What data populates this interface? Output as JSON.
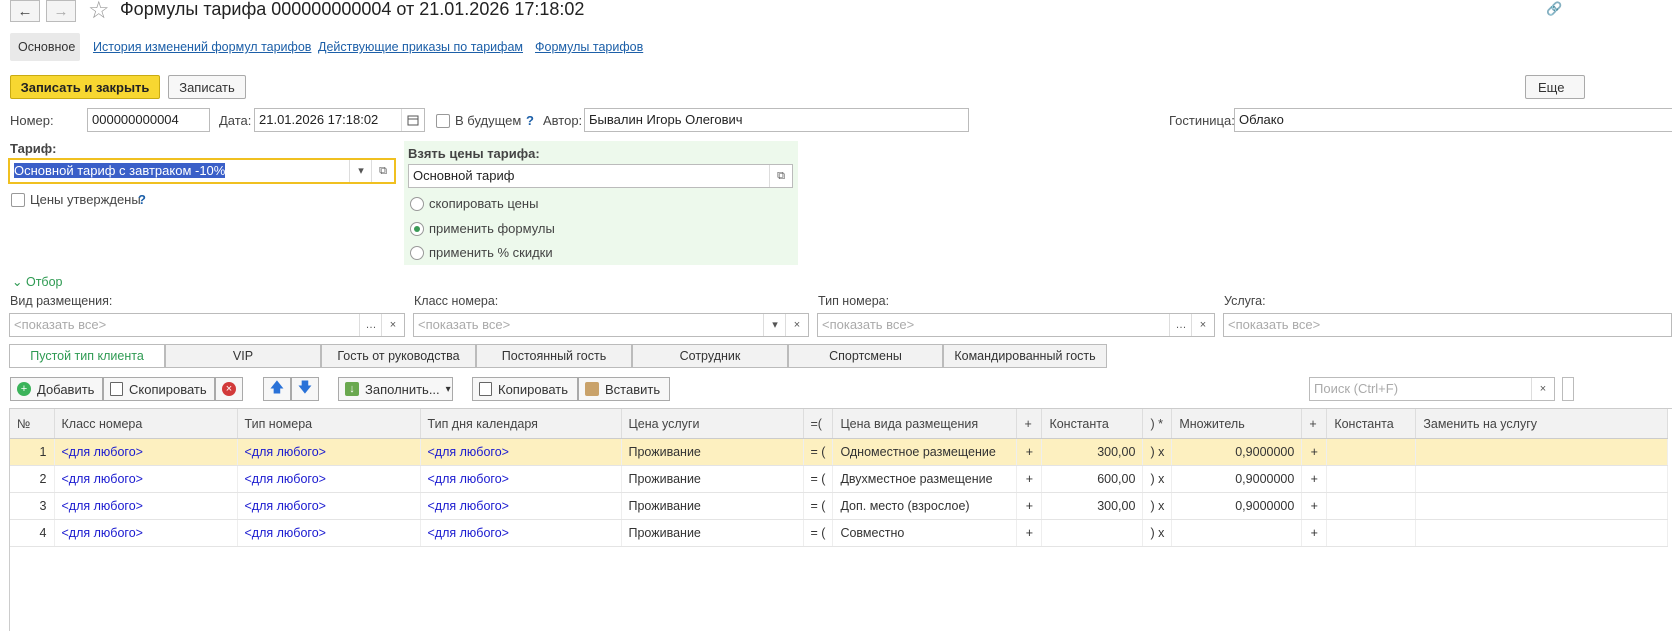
{
  "window": {
    "title": "Формулы тарифа 000000000004 от 21.01.2026 17:18:02"
  },
  "nav": {
    "back": "←",
    "forward": "→",
    "star": "☆",
    "link": "🔗"
  },
  "tabs": [
    "Основное",
    "История изменений формул тарифов",
    "Действующие приказы по тарифам",
    "Формулы тарифов"
  ],
  "toolbar": {
    "save_close": "Записать и закрыть",
    "save": "Записать",
    "more": "Еще"
  },
  "header": {
    "number_label": "Номер:",
    "number_value": "000000000004",
    "date_label": "Дата:",
    "date_value": "21.01.2026 17:18:02",
    "future_label": "В будущем",
    "help": "?",
    "author_label": "Автор:",
    "author_value": "Бывалин Игорь Олегович",
    "hotel_label": "Гостиница:",
    "hotel_value": "Облако"
  },
  "tariff": {
    "label": "Тариф:",
    "value": "Основной тариф с завтраком -10%",
    "approved_label": "Цены утверждены",
    "help": "?"
  },
  "prices": {
    "label": "Взять цены тарифа:",
    "value": "Основной тариф",
    "options": [
      {
        "label": "скопировать цены",
        "selected": false
      },
      {
        "label": "применить формулы",
        "selected": true
      },
      {
        "label": "применить % скидки",
        "selected": false
      }
    ]
  },
  "filter": {
    "toggle": "Отбор",
    "placement_label": "Вид размещения:",
    "room_class_label": "Класс номера:",
    "room_type_label": "Тип номера:",
    "service_label": "Услуга:",
    "placeholder": "<показать все>"
  },
  "client_tabs": [
    "Пустой тип клиента",
    "VIP",
    "Гость от руководства",
    "Постоянный гость",
    "Сотрудник",
    "Спортсмены",
    "Командированный гость"
  ],
  "table_toolbar": {
    "add": "Добавить",
    "copy": "Скопировать",
    "fill": "Заполнить...",
    "copy2": "Копировать",
    "paste": "Вставить",
    "search_placeholder": "Поиск (Ctrl+F)"
  },
  "table": {
    "columns": [
      "№",
      "Класс номера",
      "Тип номера",
      "Тип дня календаря",
      "Цена услуги",
      "=(",
      "Цена вида размещения",
      "+",
      "Константа",
      ") *",
      "Множитель",
      "+",
      "Константа",
      "Заменить на услугу"
    ],
    "rows": [
      [
        "1",
        "<для любого>",
        "<для любого>",
        "<для любого>",
        "Проживание",
        "= (",
        "Одноместное размещение",
        "+",
        "300,00",
        ") x",
        "0,9000000",
        "+",
        "",
        ""
      ],
      [
        "2",
        "<для любого>",
        "<для любого>",
        "<для любого>",
        "Проживание",
        "= (",
        "Двухместное размещение",
        "+",
        "600,00",
        ") x",
        "0,9000000",
        "+",
        "",
        ""
      ],
      [
        "3",
        "<для любого>",
        "<для любого>",
        "<для любого>",
        "Проживание",
        "= (",
        "Доп. место (взрослое)",
        "+",
        "300,00",
        ") x",
        "0,9000000",
        "+",
        "",
        ""
      ],
      [
        "4",
        "<для любого>",
        "<для любого>",
        "<для любого>",
        "Проживание",
        "= (",
        "Совместно",
        "+",
        "",
        ") x",
        "",
        "+",
        "",
        ""
      ]
    ]
  }
}
